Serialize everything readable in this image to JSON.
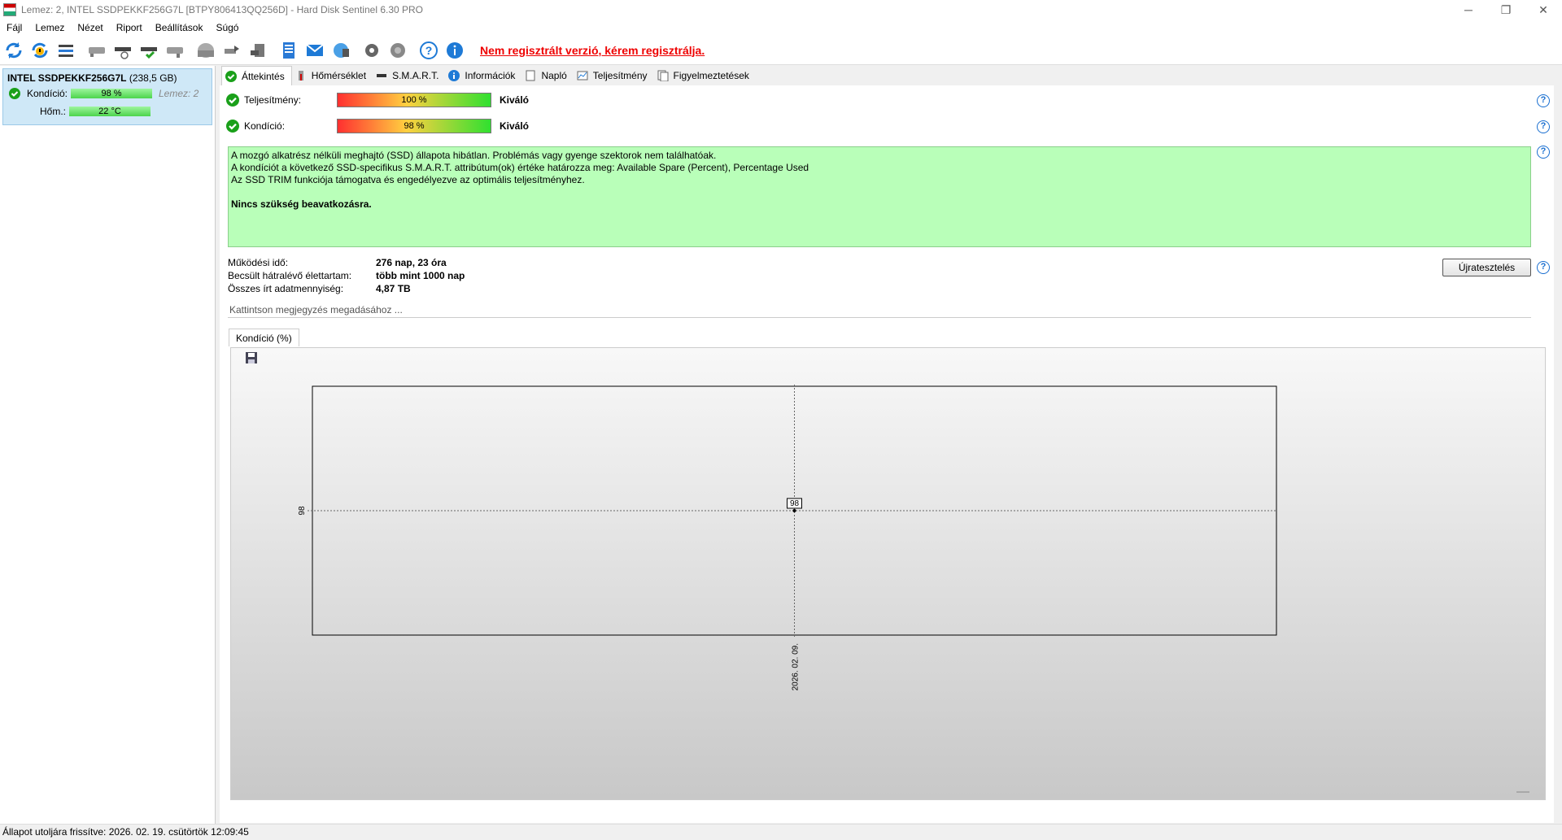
{
  "window": {
    "title": "Lemez: 2, INTEL SSDPEKKF256G7L [BTPY806413QQ256D]  -  Hard Disk Sentinel 6.30 PRO",
    "controls": [
      "─",
      "❐",
      "✕"
    ]
  },
  "menu": [
    "Fájl",
    "Lemez",
    "Nézet",
    "Riport",
    "Beállítások",
    "Súgó"
  ],
  "toolbar": {
    "icons": [
      "refresh-icon",
      "refresh-warning-icon",
      "disk-list-icon",
      "disk-icon",
      "disk-temp-icon",
      "disk-ok-icon",
      "disk-gray-icon",
      "disk-surface-icon",
      "disk-tools-icon",
      "disk-export-icon",
      "report-icon",
      "email-icon",
      "network-icon",
      "settings-icon",
      "speaker-icon",
      "help-icon",
      "info-icon"
    ],
    "register_text": "Nem regisztrált verzió, kérem regisztrálja."
  },
  "sidebar": {
    "disk_name": "INTEL SSDPEKKF256G7L",
    "disk_size": "(238,5 GB)",
    "health_label": "Kondíció:",
    "health_value": "98 %",
    "disk_number": "Lemez: 2",
    "temp_label": "Hőm.:",
    "temp_value": "22 °C"
  },
  "tabs": [
    {
      "label": "Áttekintés",
      "icon": "check-icon"
    },
    {
      "label": "Hőmérséklet",
      "icon": "thermometer-icon"
    },
    {
      "label": "S.M.A.R.T.",
      "icon": "disk-small-icon"
    },
    {
      "label": "Információk",
      "icon": "info-icon"
    },
    {
      "label": "Napló",
      "icon": "log-icon"
    },
    {
      "label": "Teljesítmény",
      "icon": "performance-icon"
    },
    {
      "label": "Figyelmeztetések",
      "icon": "alerts-icon"
    }
  ],
  "overview": {
    "performance_label": "Teljesítmény:",
    "performance_value": "100 %",
    "performance_percent": 100,
    "performance_grade": "Kiváló",
    "health_label": "Kondíció:",
    "health_value": "98 %",
    "health_percent": 98,
    "health_grade": "Kiváló",
    "status_lines": [
      "A mozgó alkatrész nélküli meghajtó (SSD) állapota hibátlan. Problémás vagy gyenge szektorok nem találhatóak.",
      "A kondíciót a következő SSD-specifikus S.M.A.R.T. attribútum(ok) értéke határozza meg:  Available Spare (Percent), Percentage Used",
      "Az SSD TRIM funkciója támogatva és engedélyezve az optimális teljesítményhez."
    ],
    "status_conclusion": "Nincs szükség beavatkozásra.",
    "uptime_label": "Működési idő:",
    "uptime_value": "276 nap, 23 óra",
    "lifetime_label": "Becsült hátralévő élettartam:",
    "lifetime_value": "több mint 1000 nap",
    "written_label": "Összes írt adatmennyiség:",
    "written_value": "4,87 TB",
    "retest_button": "Újratesztelés",
    "note_placeholder": "Kattintson megjegyzés megadásához ..."
  },
  "chart_tab": "Kondíció  (%)",
  "chart_data": {
    "type": "line",
    "title": "",
    "x": [
      "2026. 02. 09."
    ],
    "series": [
      {
        "name": "",
        "values": [
          98
        ]
      }
    ],
    "y_tick_labels": [
      "98"
    ],
    "point_labels": [
      "98"
    ],
    "grid": true
  },
  "statusbar": {
    "text": "Állapot utoljára frissítve: 2026. 02. 19. csütörtök 12:09:45"
  },
  "colors": {
    "status_bg": "#b9ffb9",
    "selected_disk_bg": "#cfe8f7",
    "register_link": "#e00000",
    "help_blue": "#1a6fd0"
  }
}
